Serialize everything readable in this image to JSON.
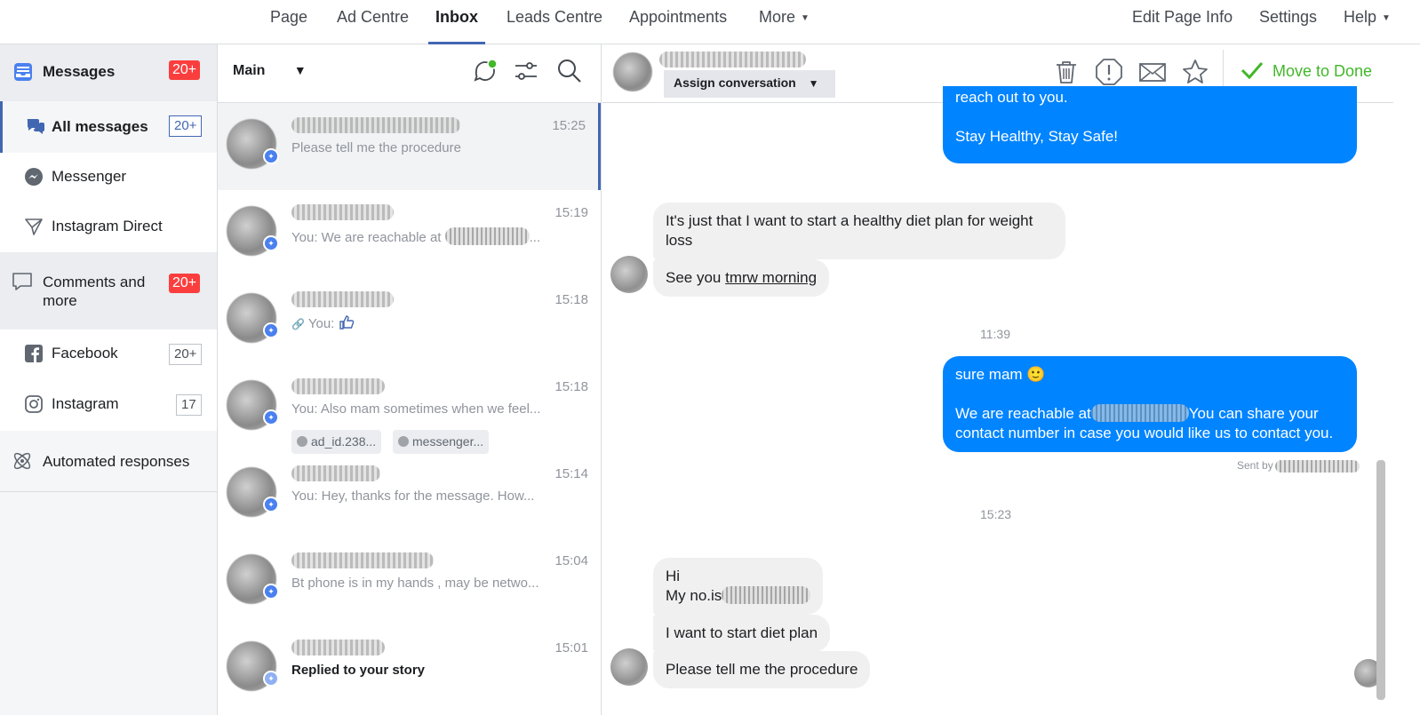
{
  "topnav": {
    "tabs": [
      {
        "label": "Page"
      },
      {
        "label": "Ad Centre"
      },
      {
        "label": "Inbox"
      },
      {
        "label": "Leads Centre"
      },
      {
        "label": "Appointments"
      },
      {
        "label": "More"
      }
    ],
    "right": [
      {
        "label": "Edit Page Info"
      },
      {
        "label": "Settings"
      },
      {
        "label": "Help"
      }
    ]
  },
  "sidebar": {
    "messages": {
      "label": "Messages",
      "badge": "20+"
    },
    "all_messages": {
      "label": "All messages",
      "badge": "20+"
    },
    "messenger": {
      "label": "Messenger"
    },
    "instagram_direct": {
      "label": "Instagram Direct"
    },
    "comments": {
      "label": "Comments and more",
      "badge": "20+"
    },
    "facebook": {
      "label": "Facebook",
      "badge": "20+"
    },
    "instagram": {
      "label": "Instagram",
      "badge": "17"
    },
    "automated": {
      "label": "Automated responses"
    }
  },
  "conversation_list": {
    "filter_label": "Main",
    "items": [
      {
        "preview": "Please tell me the procedure",
        "time": "15:25"
      },
      {
        "preview": "You: We are reachable at",
        "time": "15:19"
      },
      {
        "preview": "You:",
        "time": "15:18"
      },
      {
        "preview": "You: Also mam sometimes when we feel...",
        "time": "15:18",
        "chips": [
          "ad_id.238...",
          "messenger..."
        ]
      },
      {
        "preview": "You: Hey, thanks for the message. How...",
        "time": "15:14"
      },
      {
        "preview": "Bt phone is in my hands , may be netwo...",
        "time": "15:04"
      },
      {
        "preview": "Replied to your story",
        "time": "15:01"
      }
    ]
  },
  "chat": {
    "assign_label": "Assign conversation",
    "move_done_label": "Move to Done",
    "messages": {
      "out1_line1": "reach out to you.",
      "out1_line2": "Stay Healthy, Stay Safe!",
      "in1": "It's just that I want to start a healthy diet plan for weight loss",
      "in2_a": "See you ",
      "in2_b": "tmrw morning",
      "ts1": "11:39",
      "out2_line1": "sure mam 🙂",
      "out2_line2a": "We are reachable at",
      "out2_line2b": "You can share your contact number in case you would like us to contact you.",
      "sent_by": "Sent by",
      "ts2": "15:23",
      "in3_line1": "Hi",
      "in3_line2": "My no.is",
      "in4": "I want to start diet plan",
      "in5": "Please tell me the procedure"
    }
  },
  "colors": {
    "accent": "#4267b2",
    "outgoing_bubble": "#0084ff",
    "done_green": "#42b72a",
    "badge_red": "#fa3e3e"
  }
}
